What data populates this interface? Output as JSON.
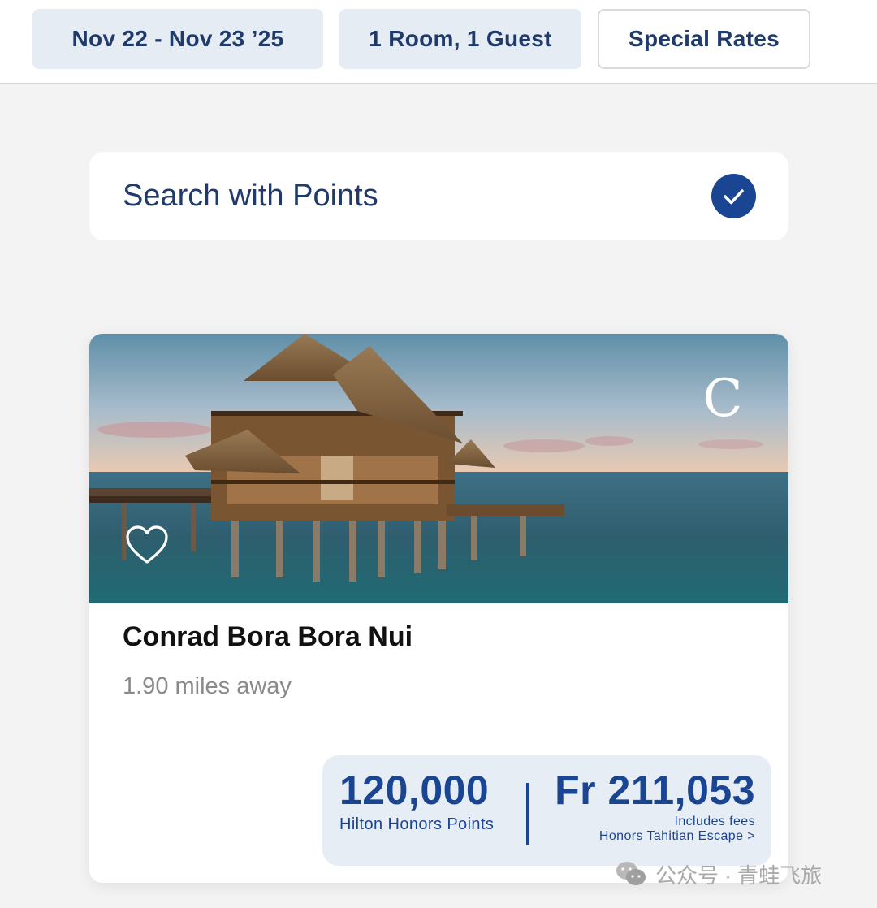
{
  "filters": {
    "dates": "Nov 22 - Nov 23 ’25",
    "occupancy": "1 Room, 1 Guest",
    "special_rates": "Special Rates"
  },
  "points_toggle": {
    "label": "Search with Points",
    "checked": true
  },
  "hotel": {
    "name": "Conrad Bora Bora Nui",
    "distance": "1.90 miles away",
    "brand_mark": "C",
    "favorite_icon": "heart-outline-icon",
    "rate": {
      "points": "120,000",
      "points_label": "Hilton Honors Points",
      "cash": "Fr 211,053",
      "fees_note": "Includes fees",
      "package": "Honors Tahitian Escape >"
    }
  },
  "watermark": {
    "text": "公众号 · 青蛙飞旅",
    "icon": "wechat-icon"
  },
  "colors": {
    "primary": "#1a4592",
    "chip_bg": "#e6ecf3",
    "page_bg": "#f3f3f3",
    "rate_bg": "#e6edf5"
  }
}
